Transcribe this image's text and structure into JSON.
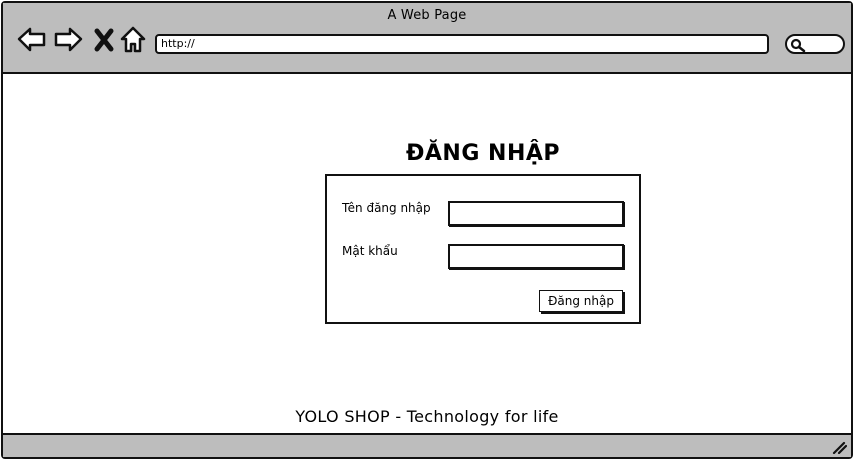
{
  "browser": {
    "window_title": "A Web Page",
    "url": "http://",
    "nav_icons": [
      "back-arrow-icon",
      "forward-arrow-icon",
      "stop-icon",
      "home-icon"
    ],
    "search_icon": "magnifier-icon"
  },
  "login": {
    "heading": "ĐĂNG NHẬP",
    "username_label": "Tên đăng nhập",
    "username_value": "",
    "password_label": "Mật khẩu",
    "password_value": "",
    "submit_label": "Đăng nhập"
  },
  "footer": {
    "text": "YOLO SHOP - Technology for life"
  },
  "colors": {
    "chrome": "#bdbdbd",
    "stroke": "#111111",
    "background": "#ffffff"
  }
}
